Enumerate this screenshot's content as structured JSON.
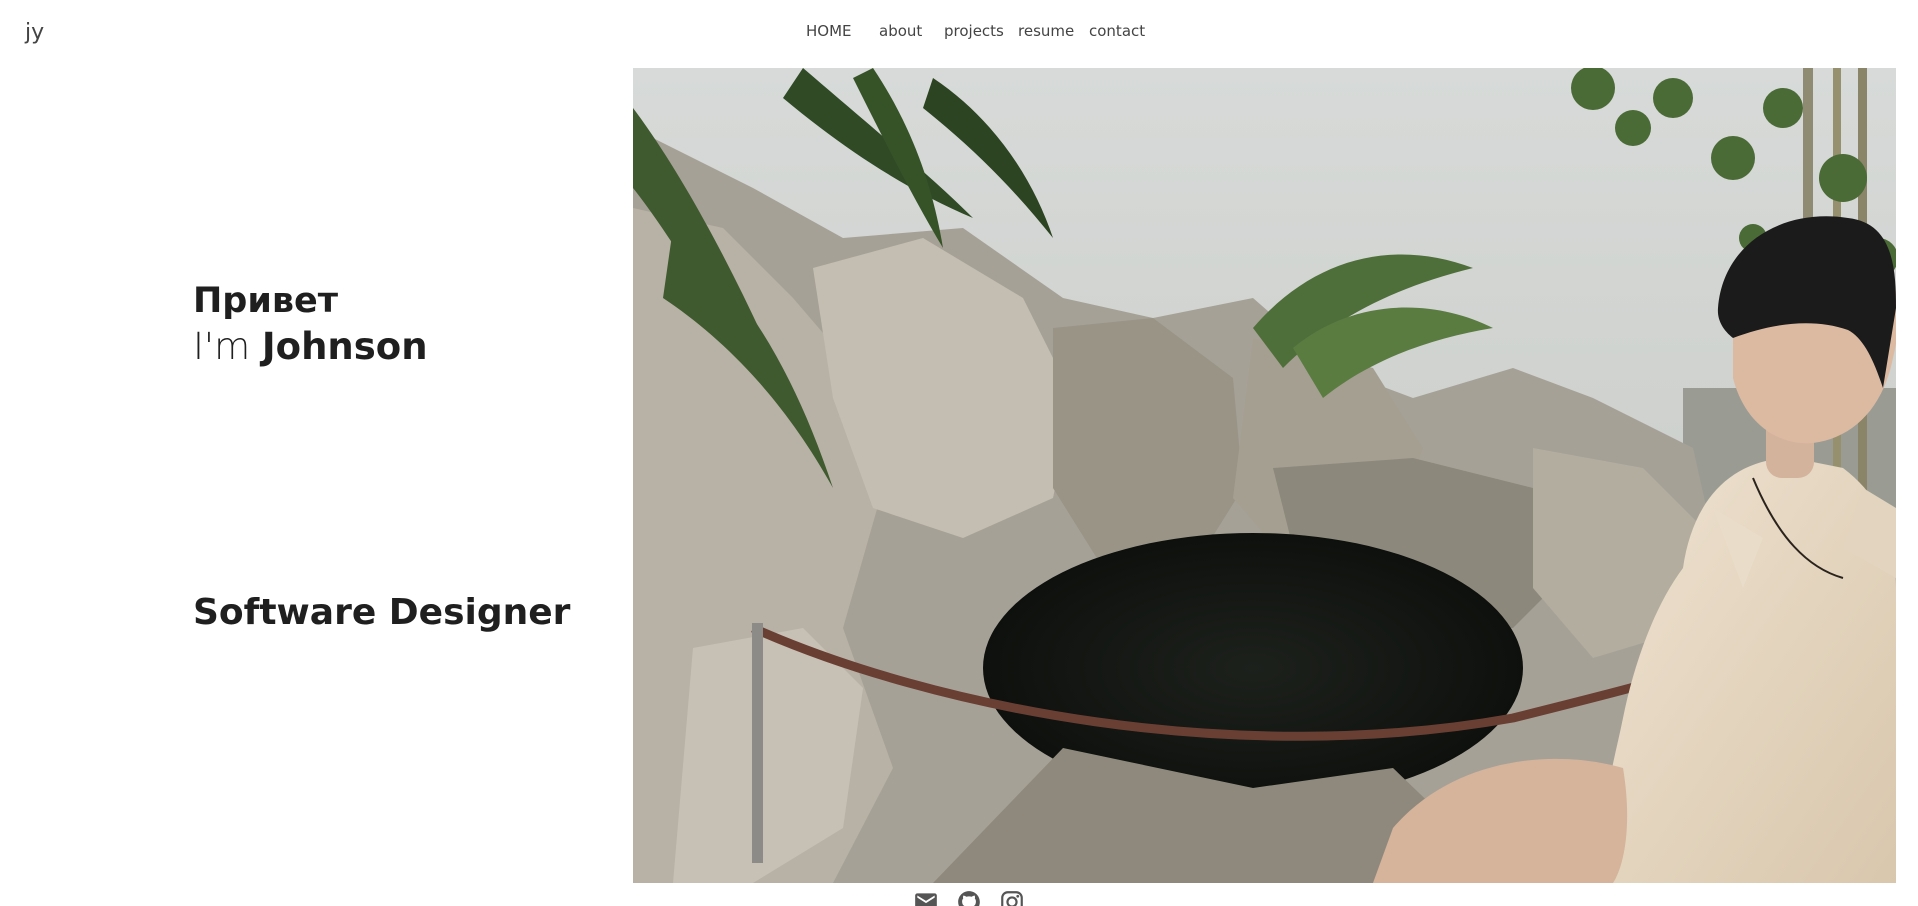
{
  "brand": {
    "logo": "jy"
  },
  "nav": {
    "items": [
      {
        "label": "HOME"
      },
      {
        "label": "about"
      },
      {
        "label": "projects"
      },
      {
        "label": "resume"
      },
      {
        "label": "contact"
      }
    ]
  },
  "hero": {
    "greeting": "Привет",
    "intro_prefix": "I'm ",
    "name": "Johnson",
    "role": "Software Designer"
  },
  "photo": {
    "alt": "Young man in a cream knit shirt sitting beside a rock garden pond"
  },
  "socials": {
    "icons": [
      "mail-icon",
      "github-icon",
      "instagram-icon"
    ],
    "icon_color": "#555555"
  }
}
